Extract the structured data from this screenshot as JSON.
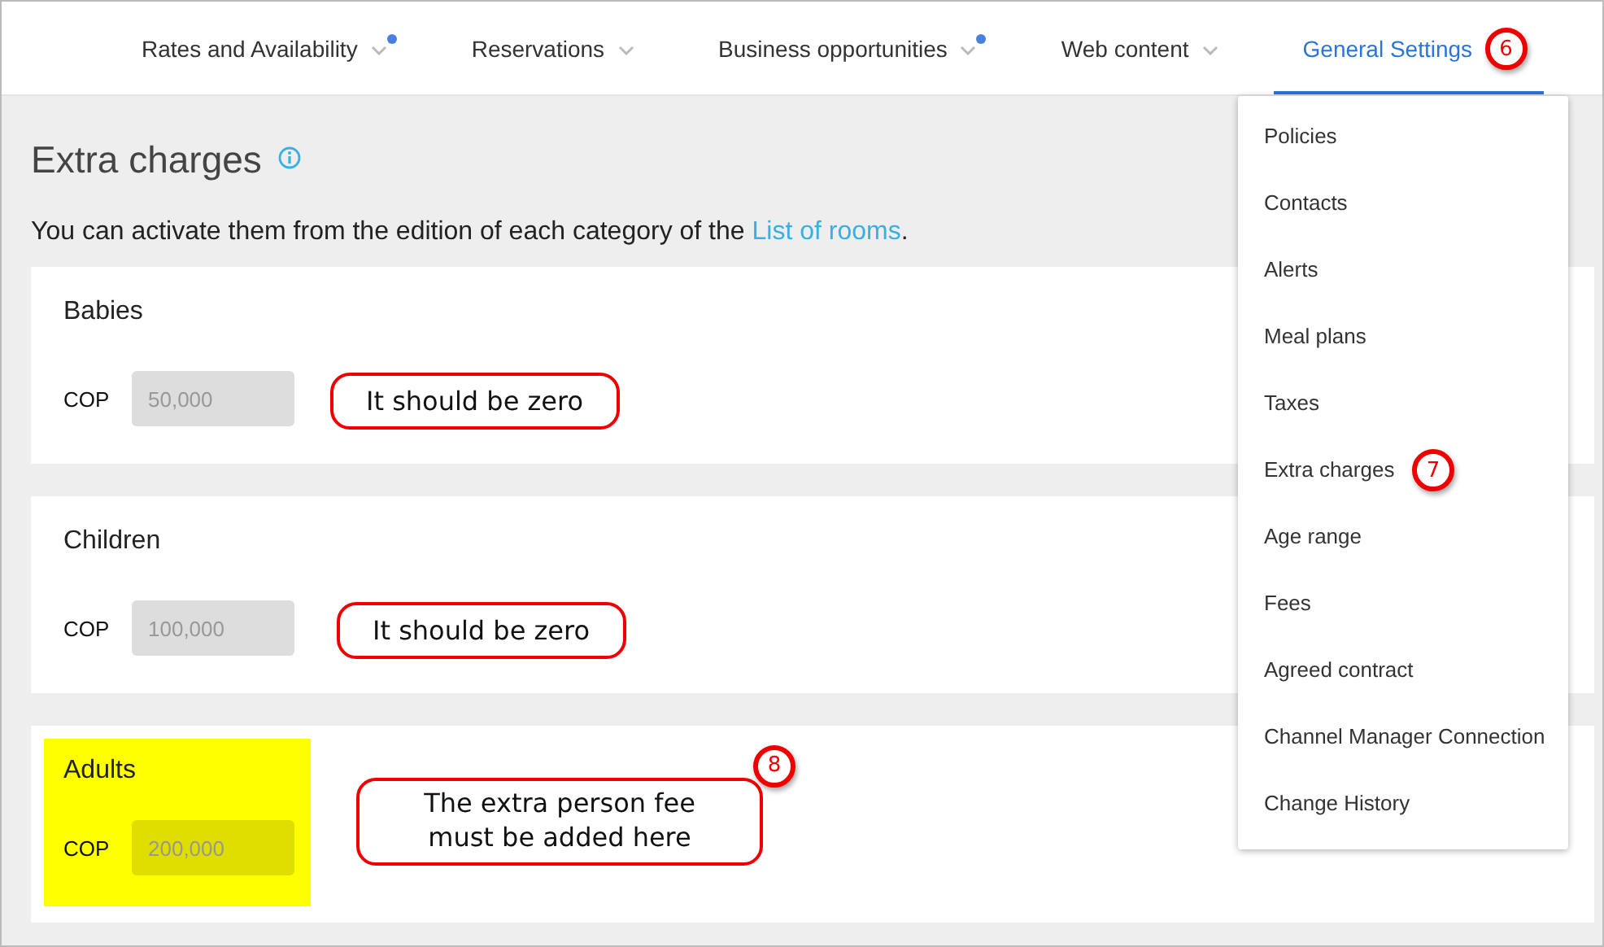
{
  "tabs": [
    {
      "label": "Rates and Availability",
      "selected": false,
      "dot": true
    },
    {
      "label": "Reservations",
      "selected": false,
      "dot": false
    },
    {
      "label": "Business opportunities",
      "selected": false,
      "dot": true
    },
    {
      "label": "Web content",
      "selected": false,
      "dot": false
    },
    {
      "label": "General Settings",
      "selected": true,
      "dot": false,
      "badge": "6"
    }
  ],
  "title": "Extra charges",
  "description": {
    "text": "You can activate them from the edition of each category of the ",
    "link": "List of rooms",
    "end": "."
  },
  "categories": [
    {
      "name": "Babies",
      "currency": "COP",
      "value": "50,000",
      "highlighted": false,
      "note": "It should be zero"
    },
    {
      "name": "Children",
      "currency": "COP",
      "value": "100,000",
      "highlighted": false,
      "note": "It should be zero"
    },
    {
      "name": "Adults",
      "currency": "COP",
      "value": "200,000",
      "highlighted": true,
      "note": "The extra person fee must be added here",
      "badge": "8"
    }
  ],
  "menu": [
    {
      "label": "Policies"
    },
    {
      "label": "Contacts"
    },
    {
      "label": "Alerts"
    },
    {
      "label": "Meal plans"
    },
    {
      "label": "Taxes"
    },
    {
      "label": "Extra charges",
      "badge": "7"
    },
    {
      "label": "Age range"
    },
    {
      "label": "Fees"
    },
    {
      "label": "Agreed contract"
    },
    {
      "label": "Channel Manager Connection"
    },
    {
      "label": "Change History"
    }
  ]
}
